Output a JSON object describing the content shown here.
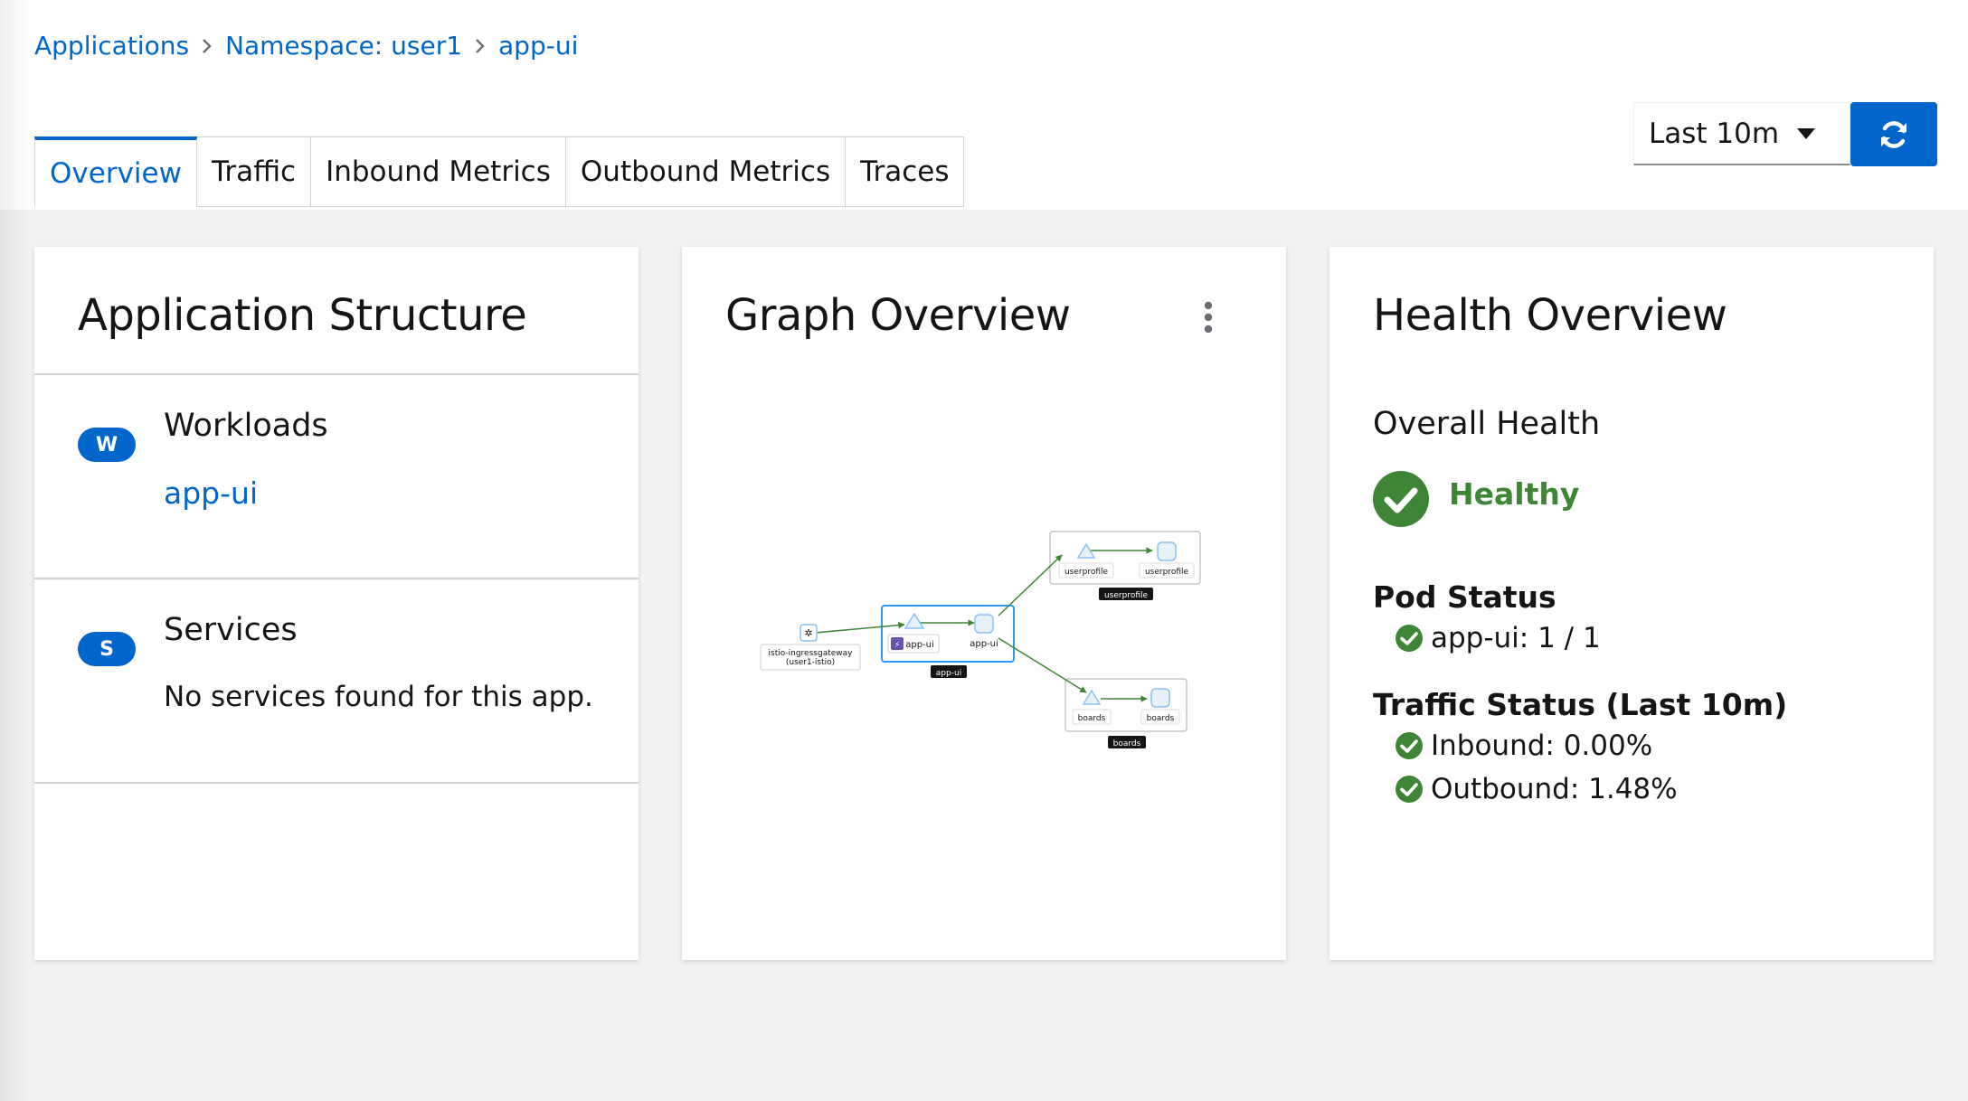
{
  "breadcrumb": {
    "items": [
      "Applications",
      "Namespace: user1",
      "app-ui"
    ]
  },
  "tabs": [
    "Overview",
    "Traffic",
    "Inbound Metrics",
    "Outbound Metrics",
    "Traces"
  ],
  "active_tab": "Overview",
  "toolbar": {
    "time_range": "Last 10m",
    "refresh_icon": "sync-icon"
  },
  "structure_card": {
    "title": "Application Structure",
    "workloads": {
      "badge": "W",
      "heading": "Workloads",
      "items": [
        "app-ui"
      ]
    },
    "services": {
      "badge": "S",
      "heading": "Services",
      "empty_text": "No services found for this app."
    }
  },
  "graph_card": {
    "title": "Graph Overview",
    "menu_icon": "kebab-icon",
    "nodes": {
      "gateway": [
        "istio-ingressgateway",
        "(user1-istio)"
      ],
      "app_workload": "app-ui",
      "app_service": "app-ui",
      "app_box": "app-ui",
      "userprofile_workload": "userprofile",
      "userprofile_service": "userprofile",
      "userprofile_box": "userprofile",
      "boards_workload": "boards",
      "boards_service": "boards",
      "boards_box": "boards"
    }
  },
  "health_card": {
    "title": "Health Overview",
    "overall_label": "Overall Health",
    "overall_status": "Healthy",
    "pod_status_label": "Pod Status",
    "pod_status": [
      {
        "text": "app-ui: 1 / 1"
      }
    ],
    "traffic_label": "Traffic Status (Last 10m)",
    "traffic": [
      {
        "text": "Inbound: 0.00%"
      },
      {
        "text": "Outbound: 1.48%"
      }
    ]
  },
  "colors": {
    "link": "#0066cc",
    "healthy": "#3e8635",
    "node_border": "#8bc1f7",
    "edge": "#3e8635",
    "app_box_border": "#2b9af3",
    "workload_icon": "#6753ac"
  }
}
